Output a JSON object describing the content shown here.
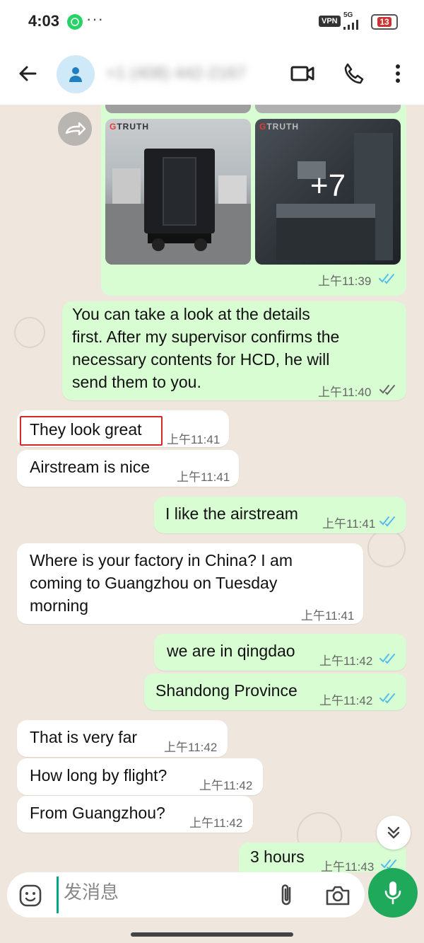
{
  "status_bar": {
    "time": "4:03",
    "dots": "···",
    "vpn": "VPN",
    "network": "5G",
    "battery": "13"
  },
  "header": {
    "contact_name": "+1 (408) 442-2167"
  },
  "media": {
    "watermark": "TRUTH",
    "more_count": "+7",
    "time": "上午11:39"
  },
  "messages": [
    {
      "id": "m1",
      "direction": "out",
      "text": "You can take a look at the details\nfirst. After my supervisor confirms the\nnecessary contents for HCD, he will\nsend them to you.",
      "time": "上午11:40",
      "status": "delivered"
    },
    {
      "id": "m2",
      "direction": "in",
      "text": "They look great",
      "time": "上午11:41"
    },
    {
      "id": "m3",
      "direction": "in",
      "text": "Airstream is nice",
      "time": "上午11:41"
    },
    {
      "id": "m4",
      "direction": "out",
      "text": "I like the airstream",
      "time": "上午11:41",
      "status": "read"
    },
    {
      "id": "m5",
      "direction": "in",
      "text": "Where is your factory in China? I am\ncoming to Guangzhou on Tuesday\nmorning",
      "time": "上午11:41"
    },
    {
      "id": "m6",
      "direction": "out",
      "text": "we are in qingdao",
      "time": "上午11:42",
      "status": "read"
    },
    {
      "id": "m7",
      "direction": "out",
      "text": "Shandong Province",
      "time": "上午11:42",
      "status": "read"
    },
    {
      "id": "m8",
      "direction": "in",
      "text": "That is very far",
      "time": "上午11:42"
    },
    {
      "id": "m9",
      "direction": "in",
      "text": "How long by flight?",
      "time": "上午11:42"
    },
    {
      "id": "m10",
      "direction": "in",
      "text": "From Guangzhou?",
      "time": "上午11:42"
    },
    {
      "id": "m11",
      "direction": "out",
      "text": "3 hours",
      "time": "上午11:43",
      "status": "read"
    }
  ],
  "composer": {
    "placeholder": "发消息"
  },
  "colors": {
    "outgoing_bubble": "#d9fdd3",
    "incoming_bubble": "#ffffff",
    "accent": "#1faa5b",
    "read_tick": "#53bdeb",
    "highlight": "#d62828"
  },
  "icons": [
    "back-arrow-icon",
    "contact-avatar-icon",
    "video-call-icon",
    "phone-icon",
    "more-vert-icon",
    "forward-icon",
    "read-ticks-icon",
    "scroll-down-icon",
    "emoji-icon",
    "attach-icon",
    "camera-icon",
    "mic-icon"
  ]
}
